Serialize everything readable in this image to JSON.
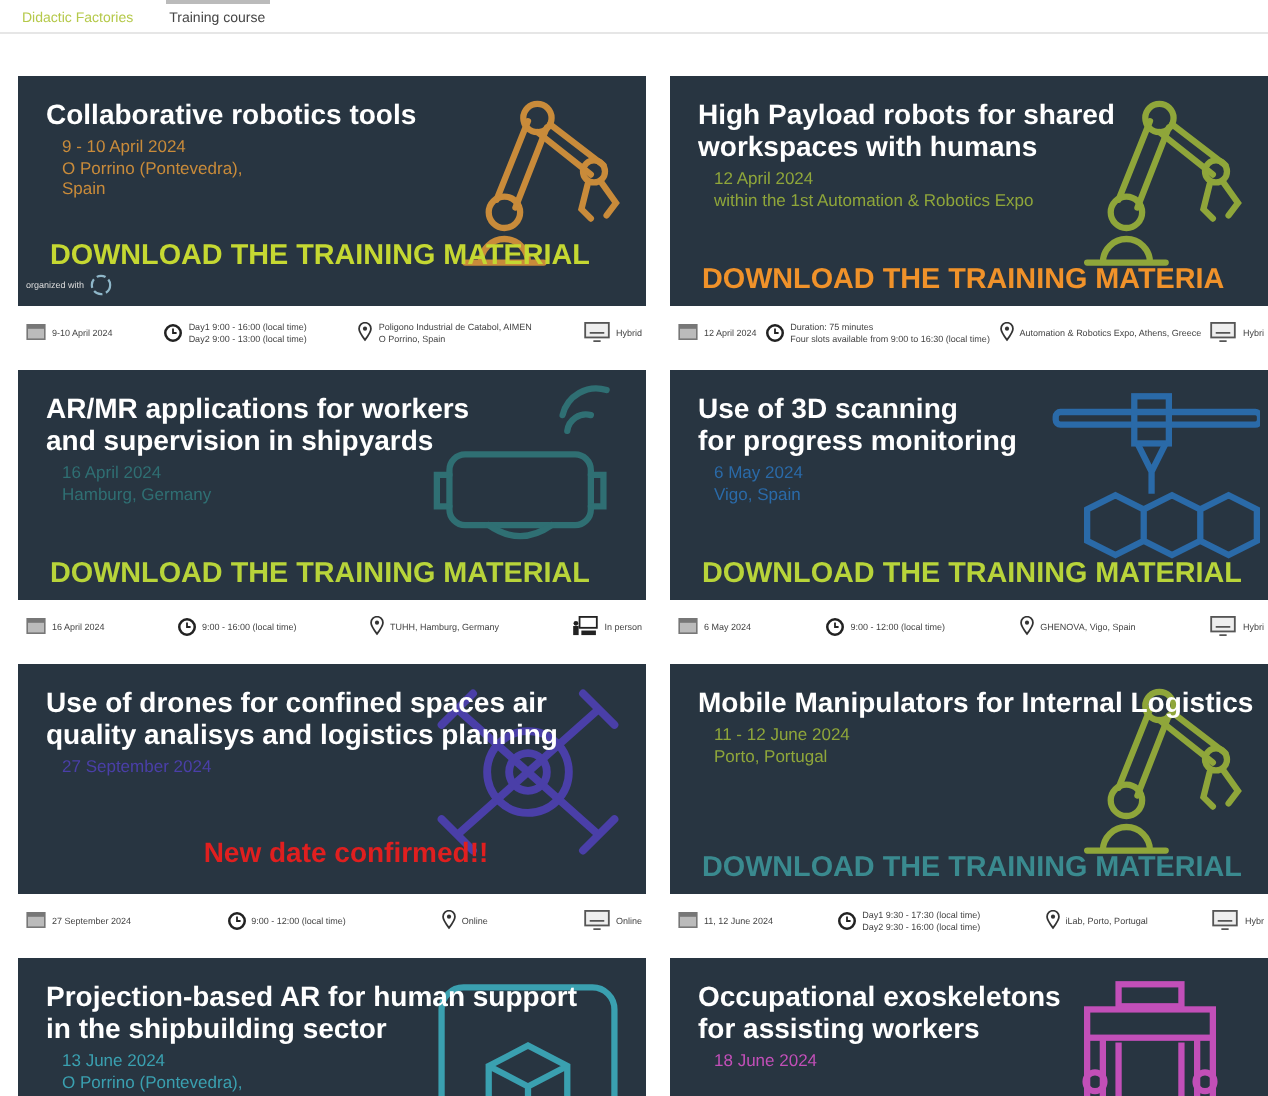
{
  "tabs": [
    {
      "label": "Didactic Factories",
      "selected": false
    },
    {
      "label": "Training course",
      "selected": true
    }
  ],
  "cards": [
    {
      "title": "Collaborative robotics tools",
      "details": [
        "9 - 10 April 2024",
        "O Porrino (Pontevedra),",
        "Spain"
      ],
      "color": "#c98b3a",
      "kind": "robot-arm",
      "cta": {
        "text": "DOWNLOAD THE TRAINING MATERIAL",
        "color": "#c5d832"
      },
      "organizer": "organized with",
      "info": {
        "date": "9-10 April 2024",
        "time": [
          "Day1 9:00 - 16:00 (local time)",
          "Day2 9:00 - 13:00 (local time)"
        ],
        "location": [
          "Poligono Industrial de Catabol, AIMEN",
          "O Porrino, Spain"
        ],
        "mode": {
          "label": "Hybrid",
          "kind": "screen"
        }
      }
    },
    {
      "title": "High Payload robots for shared\nworkspaces with humans",
      "details": [
        "12 April 2024",
        "within the 1st Automation & Robotics Expo"
      ],
      "color": "#8fa63a",
      "kind": "robot-arm",
      "cta": {
        "text": "DOWNLOAD THE TRAINING MATERIA",
        "color": "#f0922a"
      },
      "info": {
        "date": "12 April 2024",
        "time": [
          "Duration: 75 minutes",
          "Four slots available from 9:00 to 16:30 (local time)"
        ],
        "location": [
          "Automation & Robotics Expo,  Athens,  Greece"
        ],
        "mode": {
          "label": "Hybri",
          "kind": "screen"
        }
      }
    },
    {
      "title": "AR/MR applications for workers\nand supervision in shipyards",
      "details": [
        "16 April 2024",
        "Hamburg, Germany"
      ],
      "color": "#2f6f73",
      "kind": "vr-headset",
      "cta": {
        "text": "DOWNLOAD THE TRAINING MATERIAL",
        "color": "#b8d43a"
      },
      "info": {
        "date": "16 April 2024",
        "time": [
          "9:00 - 16:00 (local time)"
        ],
        "location": [
          "TUHH, Hamburg, Germany"
        ],
        "mode": {
          "label": "In person",
          "kind": "presenter"
        }
      }
    },
    {
      "title": "Use of 3D scanning\nfor progress monitoring",
      "details": [
        "6 May 2024",
        "Vigo, Spain"
      ],
      "color": "#2a6aa8",
      "kind": "printer",
      "cta": {
        "text": "DOWNLOAD THE TRAINING MATERIAL",
        "color": "#b8d43a"
      },
      "info": {
        "date": "6 May 2024",
        "time": [
          "9:00 - 12:00 (local time)"
        ],
        "location": [
          "GHENOVA, Vigo, Spain"
        ],
        "mode": {
          "label": "Hybri",
          "kind": "screen"
        }
      }
    },
    {
      "title": "Use of drones for confined spaces air\nquality analisys and logistics planning",
      "details": [
        "27 September 2024"
      ],
      "color": "#4a3fa8",
      "kind": "drone",
      "note": "New date confirmed!!",
      "info": {
        "date": "27 September 2024",
        "time": [
          "9:00 - 12:00 (local time)"
        ],
        "location": [
          "Online"
        ],
        "mode": {
          "label": "Online",
          "kind": "screen"
        }
      }
    },
    {
      "title": "Mobile Manipulators for Internal Logistics",
      "details": [
        "11 - 12 June 2024",
        "Porto, Portugal"
      ],
      "color": "#8fa63a",
      "kind": "robot-arm",
      "cta": {
        "text": "DOWNLOAD THE TRAINING MATERIAL",
        "color": "#3a8a8f"
      },
      "info": {
        "date": "11, 12 June 2024",
        "time": [
          "Day1  9:30 - 17:30 (local time)",
          "Day2  9:30 - 16:00 (local time)"
        ],
        "location": [
          "iLab, Porto, Portugal"
        ],
        "mode": {
          "label": "Hybr",
          "kind": "screen"
        }
      }
    },
    {
      "title": "Projection-based AR for human support\nin the shipbuilding sector",
      "details": [
        "13 June 2024",
        "O Porrino (Pontevedra),"
      ],
      "color": "#3aa0b0",
      "kind": "ar-box"
    },
    {
      "title": "Occupational exoskeletons\nfor assisting workers",
      "details": [
        "18 June 2024"
      ],
      "color": "#c24fb8",
      "kind": "exoskeleton"
    }
  ]
}
